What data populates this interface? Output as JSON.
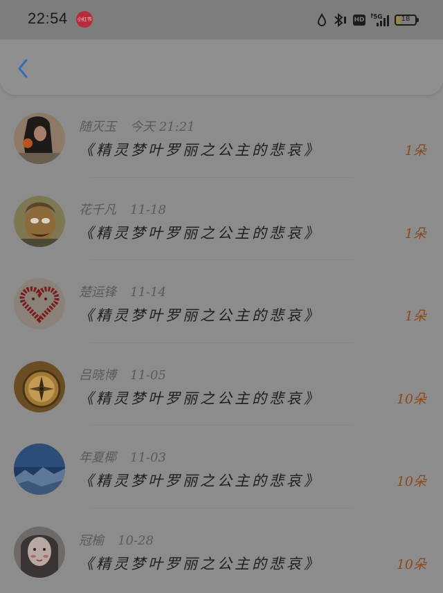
{
  "status_bar": {
    "time": "22:54",
    "app_badge": "小红书",
    "network": "5G",
    "hd": "HD",
    "battery": "18"
  },
  "nav": {
    "back_icon": "chevron-left-icon"
  },
  "items": [
    {
      "name": "随灭玉",
      "date": "今天 21:21",
      "message": "《精灵梦叶罗丽之公主的悲哀》",
      "amount": "1朵"
    },
    {
      "name": "花千凡",
      "date": "11-18",
      "message": "《精灵梦叶罗丽之公主的悲哀》",
      "amount": "1朵"
    },
    {
      "name": "楚运锋",
      "date": "11-14",
      "message": "《精灵梦叶罗丽之公主的悲哀》",
      "amount": "1朵"
    },
    {
      "name": "吕晓博",
      "date": "11-05",
      "message": "《精灵梦叶罗丽之公主的悲哀》",
      "amount": "10朵"
    },
    {
      "name": "年夏椰",
      "date": "11-03",
      "message": "《精灵梦叶罗丽之公主的悲哀》",
      "amount": "10朵"
    },
    {
      "name": "冠榆",
      "date": "10-28",
      "message": "《精灵梦叶罗丽之公主的悲哀》",
      "amount": "10朵"
    }
  ],
  "colors": {
    "overlay_gray": "#8c8c8c",
    "amount_orange": "#8a4a1e",
    "back_blue": "#2f6fb0"
  }
}
